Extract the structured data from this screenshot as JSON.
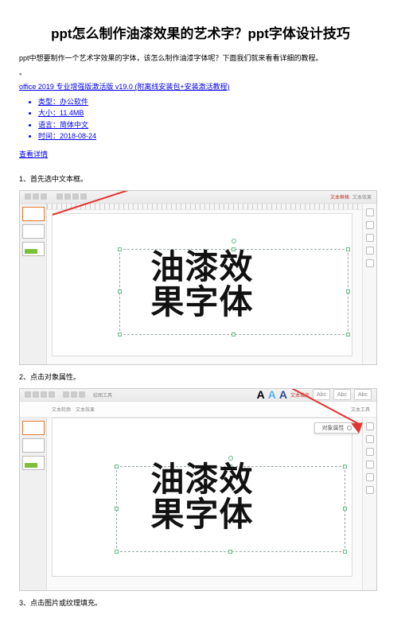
{
  "title": "ppt怎么制作油漆效果的艺术字？ppt字体设计技巧",
  "intro": "ppt中想要制作一个艺术字效果的字体，该怎么制作油漆字体呢？下面我们就来看看详细的教程。",
  "download_link": "office 2019 专业增强版激活版 v19.0 (附离线安装包+安装激活教程)",
  "meta": {
    "type_label": "类型：办公软件",
    "size_label": "大小：11.4MB",
    "lang_label": "语言：简体中文",
    "date_label": "时间：2018-08-24"
  },
  "detail_link": "查看详情",
  "steps": {
    "s1": "1、首先选中文本框。",
    "s2": "2、点击对象属性。",
    "s3": "3、点击图片或纹理填充。"
  },
  "canvas_text": {
    "line1": "油漆效",
    "line2": "果字体"
  },
  "shot2": {
    "popup_label": "对象属性",
    "fill_label": "文本填充",
    "outline_label": "文本轮廓",
    "effect_label": "文本效果",
    "style_abc": "Abc",
    "toolbar_hint": "绘图工具",
    "format_hint": "文本工具"
  },
  "shot1": {
    "right_label1": "文本框格",
    "right_label2": "文本效果"
  }
}
